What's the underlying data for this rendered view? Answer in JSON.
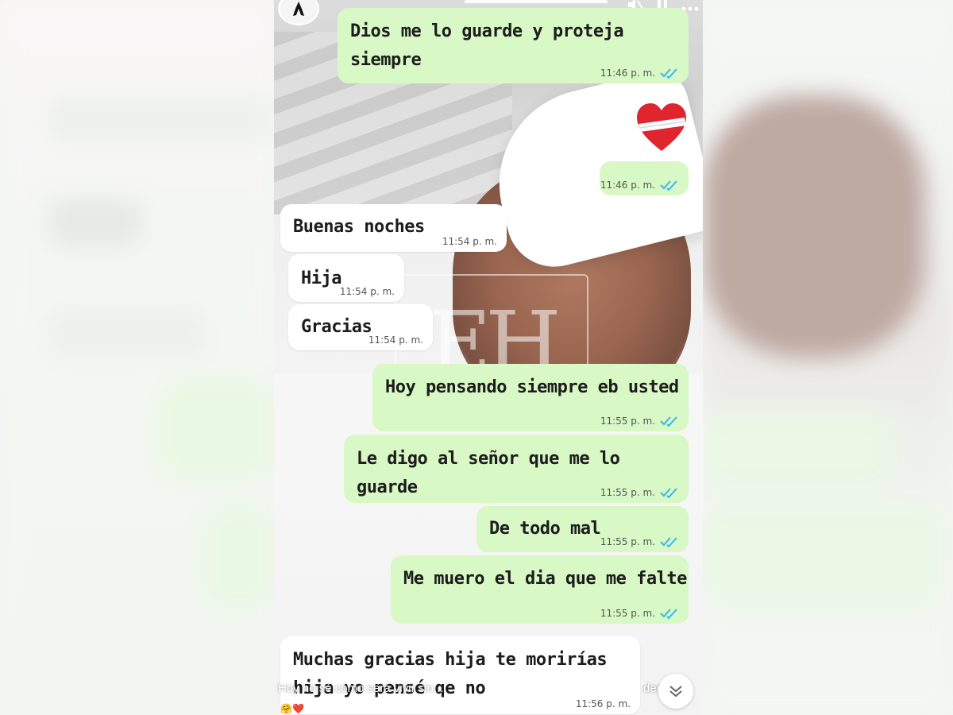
{
  "story": {
    "footer_caption": "Hoy no sé cómo será vivir sin...",
    "footer_right": "der...",
    "reactions": "🤗❤️"
  },
  "messages": [
    {
      "text": "Dios me lo guarde y proteja\nsiempre",
      "time": "11:46 p. m.",
      "direction": "out",
      "status": "read"
    },
    {
      "text": "",
      "time": "11:46 p. m.",
      "direction": "out",
      "status": "read",
      "sticker": "bandaged-heart"
    },
    {
      "text": "Buenas noches",
      "time": "11:54 p. m.",
      "direction": "in"
    },
    {
      "text": "Hija",
      "time": "11:54 p. m.",
      "direction": "in"
    },
    {
      "text": "Gracias",
      "time": "11:54 p. m.",
      "direction": "in"
    },
    {
      "text": "Hoy pensando siempre eb usted",
      "time": "11:55 p. m.",
      "direction": "out",
      "status": "read"
    },
    {
      "text": "Le digo al señor que me lo guarde",
      "time": "11:55 p. m.",
      "direction": "out",
      "status": "read"
    },
    {
      "text": "De todo mal",
      "time": "11:55 p. m.",
      "direction": "out",
      "status": "read"
    },
    {
      "text": "Me muero el dia que me falte",
      "time": "11:55 p. m.",
      "direction": "out",
      "status": "read"
    },
    {
      "text": "Muchas gracias hija te morirías\nhija yo pensé qe no",
      "time": "11:56 p. m.",
      "direction": "in"
    }
  ],
  "watermark": "EH",
  "colors": {
    "outgoing_bubble": "#d8f8c5",
    "incoming_bubble": "#ffffff",
    "read_tick": "#34b7f1"
  },
  "icons": {
    "mute": "speaker-muted-icon",
    "pause": "pause-icon",
    "more": "more-icon",
    "scroll_down": "chevron-double-down-icon"
  }
}
